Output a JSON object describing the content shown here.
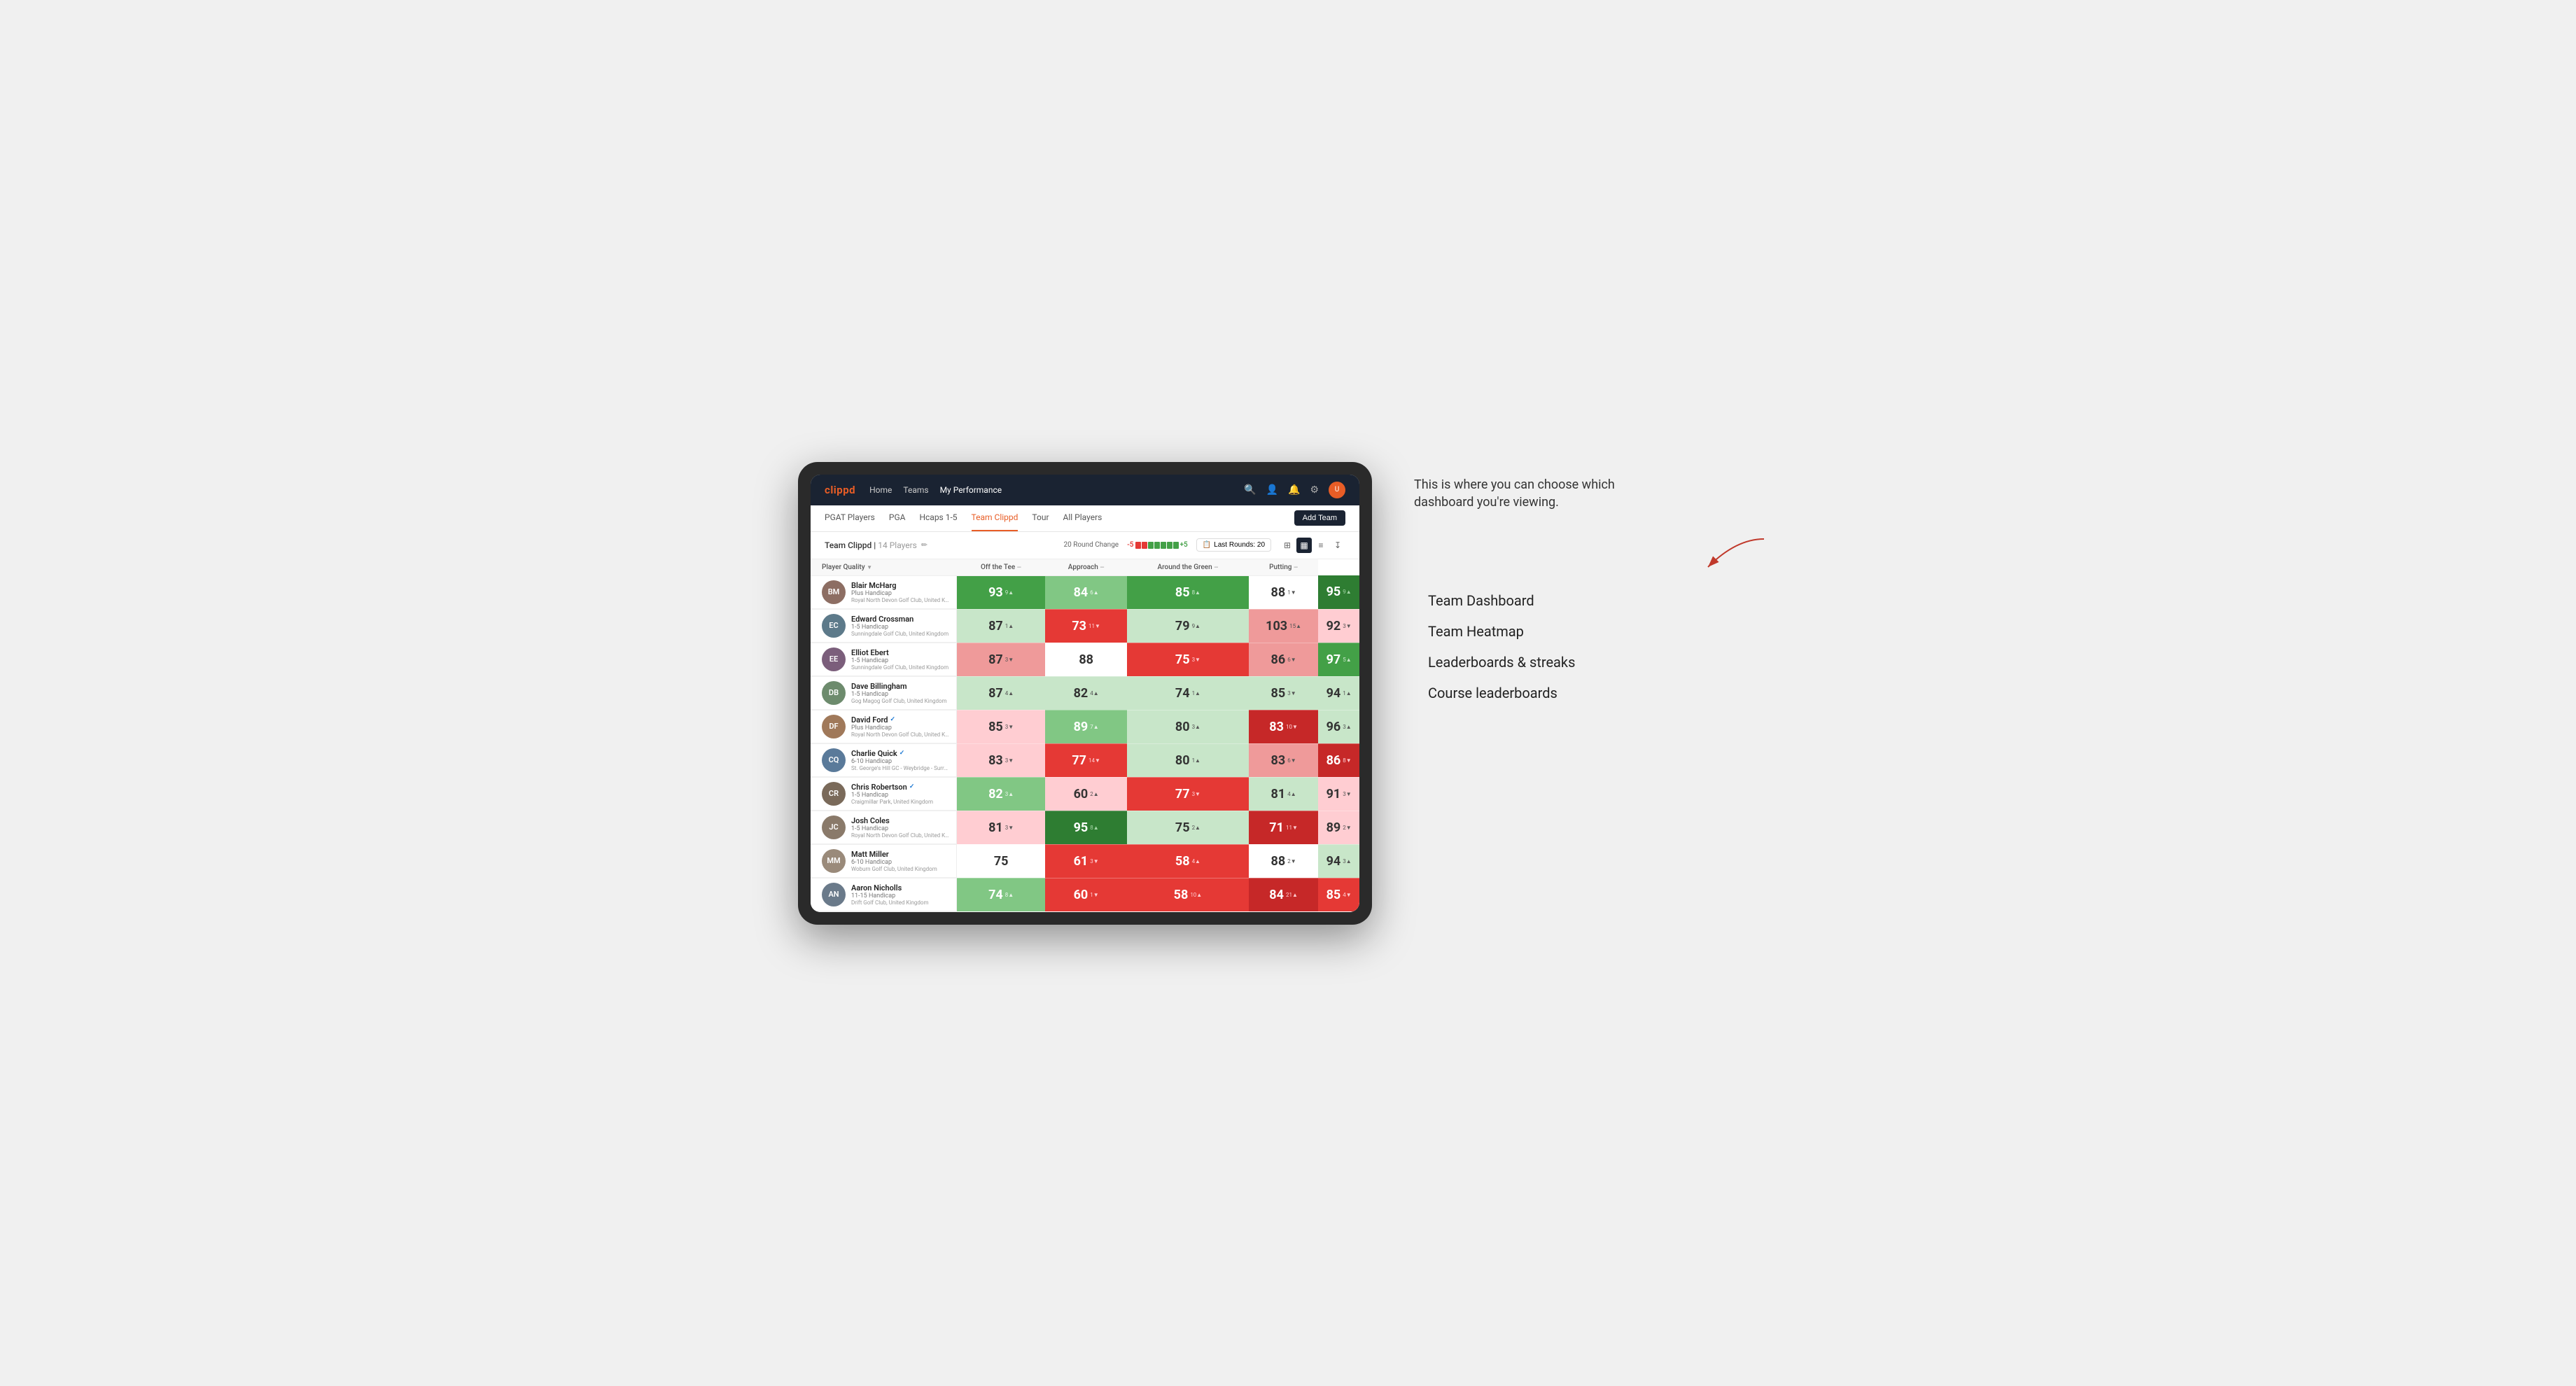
{
  "annotation": {
    "intro_text": "This is where you can choose which dashboard you're viewing.",
    "labels": [
      "Team Dashboard",
      "Team Heatmap",
      "Leaderboards & streaks",
      "Course leaderboards"
    ]
  },
  "nav": {
    "logo": "clippd",
    "links": [
      "Home",
      "Teams",
      "My Performance"
    ],
    "active_link": "My Performance"
  },
  "sub_nav": {
    "links": [
      "PGAT Players",
      "PGA",
      "Hcaps 1-5",
      "Team Clippd",
      "Tour",
      "All Players"
    ],
    "active": "Team Clippd",
    "add_team_label": "Add Team"
  },
  "team_header": {
    "title": "Team Clippd",
    "player_count": "14 Players",
    "round_change_label": "20 Round Change",
    "trend_minus": "-5",
    "trend_plus": "+5",
    "last_rounds_label": "Last Rounds:",
    "last_rounds_value": "20"
  },
  "table": {
    "columns": [
      {
        "key": "player",
        "label": "Player Quality",
        "sortable": true
      },
      {
        "key": "tee",
        "label": "Off the Tee",
        "sortable": true
      },
      {
        "key": "approach",
        "label": "Approach",
        "sortable": true
      },
      {
        "key": "around_green",
        "label": "Around the Green",
        "sortable": true
      },
      {
        "key": "putting",
        "label": "Putting",
        "sortable": true
      }
    ],
    "players": [
      {
        "name": "Blair McHarg",
        "handicap": "Plus Handicap",
        "club": "Royal North Devon Golf Club, United Kingdom",
        "avatar_color": "#8d6e63",
        "initials": "BM",
        "stats": {
          "quality": {
            "value": "93",
            "change": "9",
            "dir": "up",
            "bg": "bg-green-mid"
          },
          "tee": {
            "value": "84",
            "change": "6",
            "dir": "up",
            "bg": "bg-green-light"
          },
          "approach": {
            "value": "85",
            "change": "8",
            "dir": "up",
            "bg": "bg-green-mid"
          },
          "around": {
            "value": "88",
            "change": "1",
            "dir": "down",
            "bg": "bg-white"
          },
          "putting": {
            "value": "95",
            "change": "9",
            "dir": "up",
            "bg": "bg-green-dark"
          }
        }
      },
      {
        "name": "Edward Crossman",
        "handicap": "1-5 Handicap",
        "club": "Sunningdale Golf Club, United Kingdom",
        "avatar_color": "#5d7a8a",
        "initials": "EC",
        "stats": {
          "quality": {
            "value": "87",
            "change": "1",
            "dir": "up",
            "bg": "bg-green-pale"
          },
          "tee": {
            "value": "73",
            "change": "11",
            "dir": "down",
            "bg": "bg-red-mid"
          },
          "approach": {
            "value": "79",
            "change": "9",
            "dir": "up",
            "bg": "bg-green-pale"
          },
          "around": {
            "value": "103",
            "change": "15",
            "dir": "up",
            "bg": "bg-red-light"
          },
          "putting": {
            "value": "92",
            "change": "3",
            "dir": "down",
            "bg": "bg-red-pale"
          }
        }
      },
      {
        "name": "Elliot Ebert",
        "handicap": "1-5 Handicap",
        "club": "Sunningdale Golf Club, United Kingdom",
        "avatar_color": "#7b5e7b",
        "initials": "EE",
        "stats": {
          "quality": {
            "value": "87",
            "change": "3",
            "dir": "down",
            "bg": "bg-red-light"
          },
          "tee": {
            "value": "88",
            "change": "",
            "dir": "neutral",
            "bg": "bg-white"
          },
          "approach": {
            "value": "75",
            "change": "3",
            "dir": "down",
            "bg": "bg-red-mid"
          },
          "around": {
            "value": "86",
            "change": "6",
            "dir": "down",
            "bg": "bg-red-light"
          },
          "putting": {
            "value": "97",
            "change": "5",
            "dir": "up",
            "bg": "bg-green-mid"
          }
        }
      },
      {
        "name": "Dave Billingham",
        "handicap": "1-5 Handicap",
        "club": "Gog Magog Golf Club, United Kingdom",
        "avatar_color": "#6d8b6d",
        "initials": "DB",
        "stats": {
          "quality": {
            "value": "87",
            "change": "4",
            "dir": "up",
            "bg": "bg-green-pale"
          },
          "tee": {
            "value": "82",
            "change": "4",
            "dir": "up",
            "bg": "bg-green-pale"
          },
          "approach": {
            "value": "74",
            "change": "1",
            "dir": "up",
            "bg": "bg-green-pale"
          },
          "around": {
            "value": "85",
            "change": "3",
            "dir": "down",
            "bg": "bg-green-pale"
          },
          "putting": {
            "value": "94",
            "change": "1",
            "dir": "up",
            "bg": "bg-green-pale"
          }
        }
      },
      {
        "name": "David Ford",
        "handicap": "Plus Handicap",
        "club": "Royal North Devon Golf Club, United Kingdom",
        "avatar_color": "#a0795a",
        "initials": "DF",
        "verified": true,
        "stats": {
          "quality": {
            "value": "85",
            "change": "3",
            "dir": "down",
            "bg": "bg-red-pale"
          },
          "tee": {
            "value": "89",
            "change": "7",
            "dir": "up",
            "bg": "bg-green-light"
          },
          "approach": {
            "value": "80",
            "change": "3",
            "dir": "up",
            "bg": "bg-green-pale"
          },
          "around": {
            "value": "83",
            "change": "10",
            "dir": "down",
            "bg": "bg-red-dark"
          },
          "putting": {
            "value": "96",
            "change": "3",
            "dir": "up",
            "bg": "bg-green-pale"
          }
        }
      },
      {
        "name": "Charlie Quick",
        "handicap": "6-10 Handicap",
        "club": "St. George's Hill GC - Weybridge - Surrey, Uni...",
        "avatar_color": "#5a7a9a",
        "initials": "CQ",
        "verified": true,
        "stats": {
          "quality": {
            "value": "83",
            "change": "3",
            "dir": "down",
            "bg": "bg-red-pale"
          },
          "tee": {
            "value": "77",
            "change": "14",
            "dir": "down",
            "bg": "bg-red-mid"
          },
          "approach": {
            "value": "80",
            "change": "1",
            "dir": "up",
            "bg": "bg-green-pale"
          },
          "around": {
            "value": "83",
            "change": "6",
            "dir": "down",
            "bg": "bg-red-light"
          },
          "putting": {
            "value": "86",
            "change": "8",
            "dir": "down",
            "bg": "bg-red-dark"
          }
        }
      },
      {
        "name": "Chris Robertson",
        "handicap": "1-5 Handicap",
        "club": "Craigmillar Park, United Kingdom",
        "avatar_color": "#7a6a5a",
        "initials": "CR",
        "verified": true,
        "stats": {
          "quality": {
            "value": "82",
            "change": "3",
            "dir": "up",
            "bg": "bg-green-light"
          },
          "tee": {
            "value": "60",
            "change": "2",
            "dir": "up",
            "bg": "bg-red-pale"
          },
          "approach": {
            "value": "77",
            "change": "3",
            "dir": "down",
            "bg": "bg-red-mid"
          },
          "around": {
            "value": "81",
            "change": "4",
            "dir": "up",
            "bg": "bg-green-pale"
          },
          "putting": {
            "value": "91",
            "change": "3",
            "dir": "down",
            "bg": "bg-red-pale"
          }
        }
      },
      {
        "name": "Josh Coles",
        "handicap": "1-5 Handicap",
        "club": "Royal North Devon Golf Club, United Kingdom",
        "avatar_color": "#8a7a6a",
        "initials": "JC",
        "stats": {
          "quality": {
            "value": "81",
            "change": "3",
            "dir": "down",
            "bg": "bg-red-pale"
          },
          "tee": {
            "value": "95",
            "change": "8",
            "dir": "up",
            "bg": "bg-green-dark"
          },
          "approach": {
            "value": "75",
            "change": "2",
            "dir": "up",
            "bg": "bg-green-pale"
          },
          "around": {
            "value": "71",
            "change": "11",
            "dir": "down",
            "bg": "bg-red-dark"
          },
          "putting": {
            "value": "89",
            "change": "2",
            "dir": "down",
            "bg": "bg-red-pale"
          }
        }
      },
      {
        "name": "Matt Miller",
        "handicap": "6-10 Handicap",
        "club": "Woburn Golf Club, United Kingdom",
        "avatar_color": "#9a8a7a",
        "initials": "MM",
        "stats": {
          "quality": {
            "value": "75",
            "change": "",
            "dir": "neutral",
            "bg": "bg-white"
          },
          "tee": {
            "value": "61",
            "change": "3",
            "dir": "down",
            "bg": "bg-red-mid"
          },
          "approach": {
            "value": "58",
            "change": "4",
            "dir": "up",
            "bg": "bg-red-mid"
          },
          "around": {
            "value": "88",
            "change": "2",
            "dir": "down",
            "bg": "bg-white"
          },
          "putting": {
            "value": "94",
            "change": "3",
            "dir": "up",
            "bg": "bg-green-pale"
          }
        }
      },
      {
        "name": "Aaron Nicholls",
        "handicap": "11-15 Handicap",
        "club": "Drift Golf Club, United Kingdom",
        "avatar_color": "#6a7a8a",
        "initials": "AN",
        "stats": {
          "quality": {
            "value": "74",
            "change": "8",
            "dir": "up",
            "bg": "bg-green-light"
          },
          "tee": {
            "value": "60",
            "change": "1",
            "dir": "down",
            "bg": "bg-red-mid"
          },
          "approach": {
            "value": "58",
            "change": "10",
            "dir": "up",
            "bg": "bg-red-mid"
          },
          "around": {
            "value": "84",
            "change": "21",
            "dir": "up",
            "bg": "bg-red-dark"
          },
          "putting": {
            "value": "85",
            "change": "4",
            "dir": "down",
            "bg": "bg-red-mid"
          }
        }
      }
    ]
  }
}
